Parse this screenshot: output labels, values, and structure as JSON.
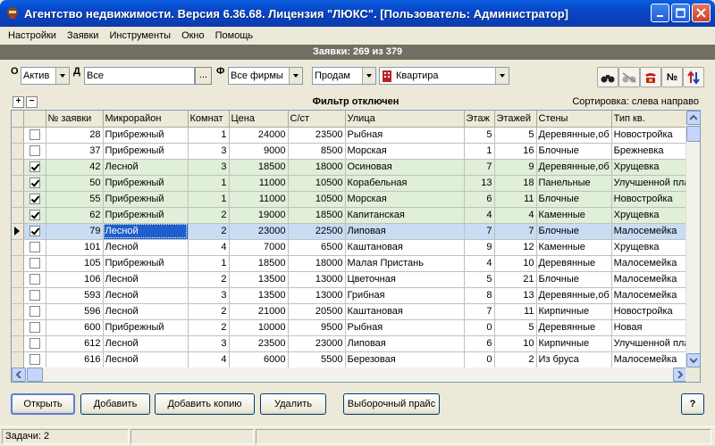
{
  "window": {
    "title": "Агентство недвижимости. Версия 6.36.68. Лицензия \"ЛЮКС\". [Пользователь: Администратор]"
  },
  "menu": [
    "Настройки",
    "Заявки",
    "Инструменты",
    "Окно",
    "Помощь"
  ],
  "header": {
    "title": "Заявки: 269 из 379"
  },
  "filters": {
    "label_o": "О",
    "status_value": "Актив",
    "label_d": "Д",
    "district_value": "Все",
    "ellipsis": "...",
    "label_f": "Ф",
    "firm_value": "Все фирмы",
    "deal_value": "Продам",
    "object_value": "Квартира"
  },
  "toolbar": {
    "number_btn": "№"
  },
  "filter_status": "Фильтр отключен",
  "sort_label": "Сортировка: слева направо",
  "grid": {
    "columns": [
      "№ заявки",
      "Микрорайон",
      "Комнат",
      "Цена",
      "С/ст",
      "Улица",
      "Этаж",
      "Этажей",
      "Стены",
      "Тип кв."
    ],
    "rows": [
      {
        "checked": false,
        "hl": "",
        "id": "28",
        "district": "Прибрежный",
        "rooms": "1",
        "price": "24000",
        "cost": "23500",
        "street": "Рыбная",
        "floor": "5",
        "floors": "5",
        "walls": "Деревянные,об",
        "type": "Новостройка"
      },
      {
        "checked": false,
        "hl": "",
        "id": "37",
        "district": "Прибрежный",
        "rooms": "3",
        "price": "9000",
        "cost": "8500",
        "street": "Морская",
        "floor": "1",
        "floors": "16",
        "walls": "Блочные",
        "type": "Брежневка"
      },
      {
        "checked": true,
        "hl": "green",
        "id": "42",
        "district": "Лесной",
        "rooms": "3",
        "price": "18500",
        "cost": "18000",
        "street": "Осиновая",
        "floor": "7",
        "floors": "9",
        "walls": "Деревянные,об",
        "type": "Хрущевка"
      },
      {
        "checked": true,
        "hl": "green",
        "id": "50",
        "district": "Прибрежный",
        "rooms": "1",
        "price": "11000",
        "cost": "10500",
        "street": "Корабельная",
        "floor": "13",
        "floors": "18",
        "walls": "Панельные",
        "type": "Улучшенной пла"
      },
      {
        "checked": true,
        "hl": "green",
        "id": "55",
        "district": "Прибрежный",
        "rooms": "1",
        "price": "11000",
        "cost": "10500",
        "street": "Морская",
        "floor": "6",
        "floors": "11",
        "walls": "Блочные",
        "type": "Новостройка"
      },
      {
        "checked": true,
        "hl": "green",
        "id": "62",
        "district": "Прибрежный",
        "rooms": "2",
        "price": "19000",
        "cost": "18500",
        "street": "Капитанская",
        "floor": "4",
        "floors": "4",
        "walls": "Каменные",
        "type": "Хрущевка"
      },
      {
        "checked": true,
        "hl": "sel",
        "id": "79",
        "district": "Лесной",
        "rooms": "2",
        "price": "23000",
        "cost": "22500",
        "street": "Липовая",
        "floor": "7",
        "floors": "7",
        "walls": "Блочные",
        "type": "Малосемейка"
      },
      {
        "checked": false,
        "hl": "",
        "id": "101",
        "district": "Лесной",
        "rooms": "4",
        "price": "7000",
        "cost": "6500",
        "street": "Каштановая",
        "floor": "9",
        "floors": "12",
        "walls": "Каменные",
        "type": "Хрущевка"
      },
      {
        "checked": false,
        "hl": "",
        "id": "105",
        "district": "Прибрежный",
        "rooms": "1",
        "price": "18500",
        "cost": "18000",
        "street": "Малая Пристань",
        "floor": "4",
        "floors": "10",
        "walls": "Деревянные",
        "type": "Малосемейка"
      },
      {
        "checked": false,
        "hl": "",
        "id": "106",
        "district": "Лесной",
        "rooms": "2",
        "price": "13500",
        "cost": "13000",
        "street": "Цветочная",
        "floor": "5",
        "floors": "21",
        "walls": "Блочные",
        "type": "Малосемейка"
      },
      {
        "checked": false,
        "hl": "",
        "id": "593",
        "district": "Лесной",
        "rooms": "3",
        "price": "13500",
        "cost": "13000",
        "street": "Грибная",
        "floor": "8",
        "floors": "13",
        "walls": "Деревянные,об",
        "type": "Малосемейка"
      },
      {
        "checked": false,
        "hl": "",
        "id": "596",
        "district": "Лесной",
        "rooms": "2",
        "price": "21000",
        "cost": "20500",
        "street": "Каштановая",
        "floor": "7",
        "floors": "11",
        "walls": "Кирпичные",
        "type": "Новостройка"
      },
      {
        "checked": false,
        "hl": "",
        "id": "600",
        "district": "Прибрежный",
        "rooms": "2",
        "price": "10000",
        "cost": "9500",
        "street": "Рыбная",
        "floor": "0",
        "floors": "5",
        "walls": "Деревянные",
        "type": "Новая"
      },
      {
        "checked": false,
        "hl": "",
        "id": "612",
        "district": "Лесной",
        "rooms": "3",
        "price": "23500",
        "cost": "23000",
        "street": "Липовая",
        "floor": "6",
        "floors": "10",
        "walls": "Кирпичные",
        "type": "Улучшенной пла"
      },
      {
        "checked": false,
        "hl": "",
        "id": "616",
        "district": "Лесной",
        "rooms": "4",
        "price": "6000",
        "cost": "5500",
        "street": "Березовая",
        "floor": "0",
        "floors": "2",
        "walls": "Из бруса",
        "type": "Малосемейка"
      }
    ]
  },
  "buttons": {
    "open": "Открыть",
    "add": "Добавить",
    "add_copy": "Добавить копию",
    "delete": "Удалить",
    "price": "Выборочный прайс",
    "help": "?"
  },
  "status": {
    "tasks": "Задачи: 2"
  },
  "colors": {
    "title_bar": "#0a4fd0",
    "header_bar": "#716f64",
    "row_green": "#dfefd8",
    "row_selected": "#c8dcf4",
    "focus_cell": "#1f5fcc"
  }
}
